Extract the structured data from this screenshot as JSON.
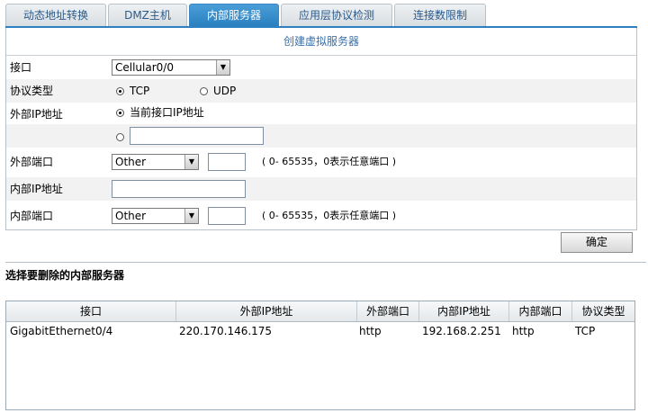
{
  "tabs": [
    {
      "label": "动态地址转换"
    },
    {
      "label": "DMZ主机"
    },
    {
      "label": "内部服务器"
    },
    {
      "label": "应用层协议检测"
    },
    {
      "label": "连接数限制"
    }
  ],
  "form": {
    "title": "创建虚拟服务器",
    "interface": {
      "label": "接口",
      "value": "Cellular0/0"
    },
    "protocol": {
      "label": "协议类型",
      "options": [
        "TCP",
        "UDP"
      ],
      "selected": "TCP"
    },
    "external_ip": {
      "label": "外部IP地址",
      "option_current": "当前接口IP地址",
      "custom_value": "",
      "selected": "current"
    },
    "external_port": {
      "label": "外部端口",
      "select_value": "Other",
      "input_value": "",
      "hint": "( 0- 65535，0表示任意端口 )"
    },
    "internal_ip": {
      "label": "内部IP地址",
      "value": ""
    },
    "internal_port": {
      "label": "内部端口",
      "select_value": "Other",
      "input_value": "",
      "hint": "( 0- 65535，0表示任意端口 )"
    },
    "ok_label": "确定"
  },
  "delete_section": {
    "title": "选择要删除的内部服务器"
  },
  "table": {
    "columns": [
      "接口",
      "外部IP地址",
      "外部端口",
      "内部IP地址",
      "内部端口",
      "协议类型"
    ],
    "rows": [
      [
        "GigabitEthernet0/4",
        "220.170.146.175",
        "http",
        "192.168.2.251",
        "http",
        "TCP"
      ]
    ]
  },
  "colors": {
    "active_tab": "#2a7fc0",
    "title_text": "#3b6fa6"
  }
}
